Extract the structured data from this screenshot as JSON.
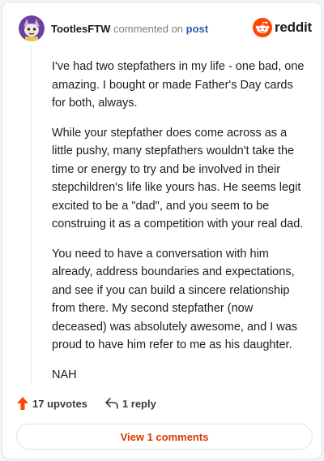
{
  "header": {
    "username": "TootlesFTW",
    "action_text": "commented on",
    "post_link": "post",
    "brand": "reddit"
  },
  "comment": {
    "paragraphs": [
      "I've had two stepfathers in my life - one bad, one amazing. I bought or made Father's Day cards for both, always.",
      "While your stepfather does come across as a little pushy, many stepfathers wouldn't take the time or energy to try and be involved in their stepchildren's life like yours has. He seems legit excited to be a \"dad\", and you seem to be construing it as a competition with your real dad.",
      "You need to have a conversation with him already, address boundaries and expectations, and see if you can build a sincere relationship from there. My second stepfather (now deceased) was absolutely awesome, and I was proud to have him refer to me as his daughter.",
      "NAH"
    ]
  },
  "actions": {
    "upvotes": "17 upvotes",
    "reply": "1 reply"
  },
  "view_comments": "View 1 comments",
  "colors": {
    "upvote": "#ff4500",
    "link": "#2a5db0",
    "view_button": "#d93a00"
  }
}
